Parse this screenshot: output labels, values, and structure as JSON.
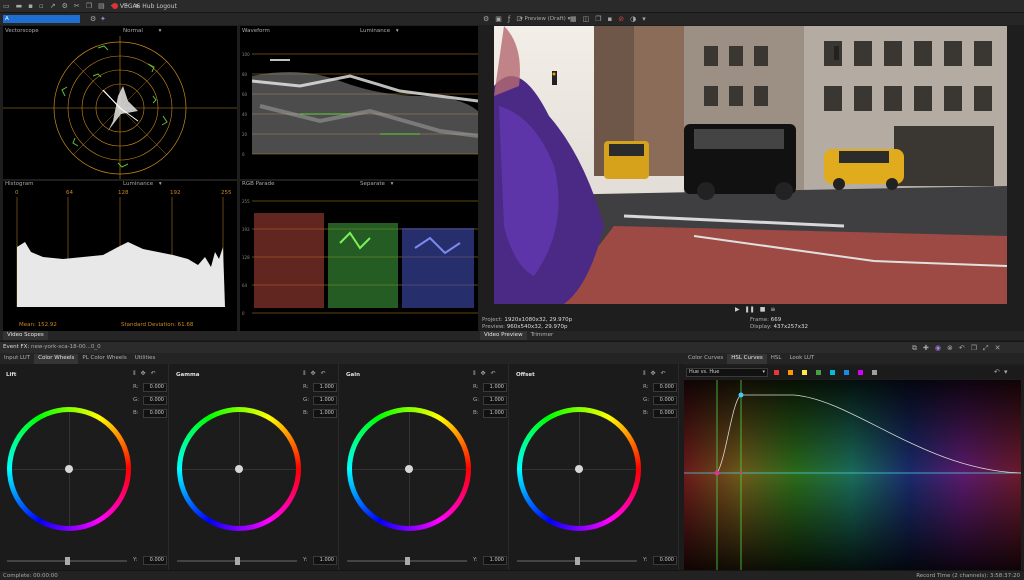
{
  "app": {
    "title": "VEGAS Hub Logout",
    "track_name": "A"
  },
  "scopes": {
    "vectorscope": {
      "title": "Vectorscope",
      "mode": "Normal"
    },
    "waveform": {
      "title": "Waveform",
      "mode": "Luminance"
    },
    "histogram": {
      "title": "Histogram",
      "mode": "Luminance",
      "ticks": [
        "0",
        "64",
        "128",
        "192",
        "255"
      ],
      "mean": "Mean: 152.92",
      "stddev": "Standard Deviation: 61.68"
    },
    "rgbparade": {
      "title": "RGB Parade",
      "mode": "Separate"
    },
    "bottom_tab": "Video Scopes"
  },
  "preview": {
    "mode": "Preview (Draft)",
    "project_label": "Project:",
    "project_value": "1920x1080x32, 29.970p",
    "preview_label": "Preview:",
    "preview_value": "960x540x32, 29.970p",
    "frame_label": "Frame:",
    "frame_value": "669",
    "display_label": "Display:",
    "display_value": "437x257x32",
    "tabs": [
      "Video Preview",
      "Trimmer"
    ]
  },
  "event_bar": {
    "label": "Event FX:",
    "event_name": "new-york-sca-18-00...0_0"
  },
  "color_grading": {
    "tabs": [
      "Input LUT",
      "Color Wheels",
      "PL Color Wheels",
      "Utilities"
    ],
    "active_tab": "Color Wheels",
    "wheels": [
      {
        "name": "Lift",
        "r": "0.000",
        "g": "0.000",
        "b": "0.000",
        "y": "0.000"
      },
      {
        "name": "Gamma",
        "r": "1.000",
        "g": "1.000",
        "b": "1.000",
        "y": "1.000"
      },
      {
        "name": "Gain",
        "r": "1.000",
        "g": "1.000",
        "b": "1.000",
        "y": "1.000"
      },
      {
        "name": "Offset",
        "r": "0.000",
        "g": "0.000",
        "b": "0.000",
        "y": "0.000"
      }
    ],
    "channel_labels": {
      "r": "R:",
      "g": "G:",
      "b": "B:",
      "y": "Y:"
    }
  },
  "curves": {
    "tabs": [
      "Color Curves",
      "HSL Curves",
      "HSL",
      "Look LUT"
    ],
    "active_tab": "HSL Curves",
    "preset": "Hue vs. Hue",
    "swatch_colors": [
      "#e53935",
      "#ff9800",
      "#ffeb3b",
      "#43a047",
      "#00bcd4",
      "#1e88e5",
      "#d500f9",
      "#9e9e9e"
    ]
  },
  "status": {
    "left": "Complete: 00:00:00",
    "right": "Record Time (2 channels): 3:58:37:20"
  },
  "colors": {
    "accent": "#1e6fcf",
    "playhead": "#30c0ff"
  }
}
